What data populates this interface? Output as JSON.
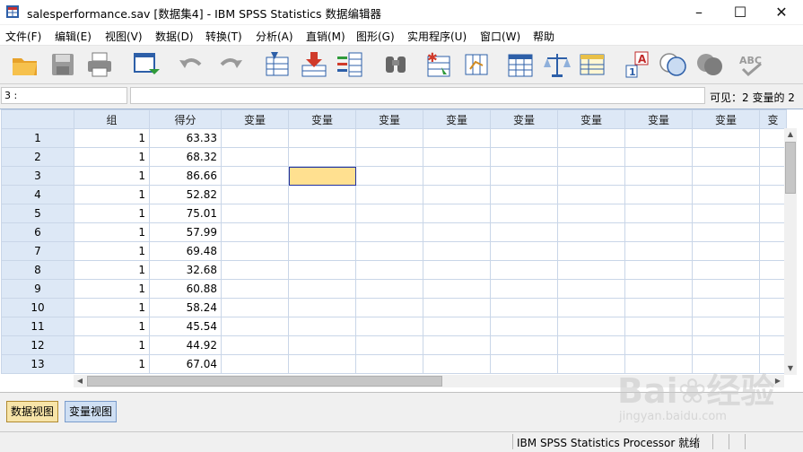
{
  "window": {
    "title": "salesperformance.sav [数据集4] - IBM SPSS Statistics 数据编辑器",
    "minimize": "–",
    "maximize": "☐",
    "close": "✕"
  },
  "menu": [
    "文件(F)",
    "编辑(E)",
    "视图(V)",
    "数据(D)",
    "转换(T)",
    "分析(A)",
    "直销(M)",
    "图形(G)",
    "实用程序(U)",
    "窗口(W)",
    "帮助"
  ],
  "toolbar": {
    "icons": [
      "open-folder-icon",
      "save-icon",
      "print-icon",
      "dialog-recall-icon",
      "undo-icon",
      "redo-icon",
      "goto-case-icon",
      "goto-variable-icon",
      "variables-icon",
      "find-icon",
      "insert-cases-icon",
      "insert-variable-icon",
      "split-file-icon",
      "weight-cases-icon",
      "select-cases-icon",
      "value-labels-icon",
      "use-sets-icon",
      "show-all-variables-icon",
      "spell-check-icon"
    ]
  },
  "cellbar": {
    "ref": "3 :",
    "value": "",
    "visible": "可见：2 变量的 2"
  },
  "grid": {
    "columns": [
      "组",
      "得分",
      "变量",
      "变量",
      "变量",
      "变量",
      "变量",
      "变量",
      "变量",
      "变量",
      "变"
    ],
    "rows": [
      {
        "n": "1",
        "g": "1",
        "s": "63.33"
      },
      {
        "n": "2",
        "g": "1",
        "s": "68.32"
      },
      {
        "n": "3",
        "g": "1",
        "s": "86.66"
      },
      {
        "n": "4",
        "g": "1",
        "s": "52.82"
      },
      {
        "n": "5",
        "g": "1",
        "s": "75.01"
      },
      {
        "n": "6",
        "g": "1",
        "s": "57.99"
      },
      {
        "n": "7",
        "g": "1",
        "s": "69.48"
      },
      {
        "n": "8",
        "g": "1",
        "s": "32.68"
      },
      {
        "n": "9",
        "g": "1",
        "s": "60.88"
      },
      {
        "n": "10",
        "g": "1",
        "s": "58.24"
      },
      {
        "n": "11",
        "g": "1",
        "s": "45.54"
      },
      {
        "n": "12",
        "g": "1",
        "s": "44.92"
      },
      {
        "n": "13",
        "g": "1",
        "s": "67.04"
      }
    ]
  },
  "tabs": {
    "data_view": "数据视图",
    "variable_view": "变量视图"
  },
  "status": {
    "processor": "IBM SPSS Statistics Processor 就绪"
  },
  "watermark": {
    "main": "Bai❀经验",
    "sub": "jingyan.baidu.com"
  },
  "colors": {
    "header_bg": "#dde8f6",
    "selected_cell": "#ffe090",
    "active_tab": "#f7e4a8"
  }
}
